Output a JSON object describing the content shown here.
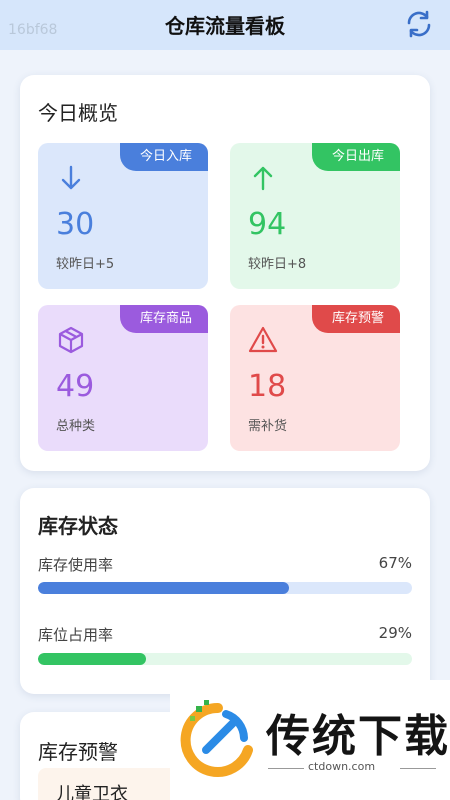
{
  "header": {
    "watermark": "16bf68",
    "title": "仓库流量看板",
    "refresh_icon": "refresh-icon"
  },
  "overview": {
    "title": "今日概览",
    "tiles": [
      {
        "badge": "今日入库",
        "value": "30",
        "sub": "较昨日+5",
        "icon": "arrow-down-icon",
        "color": "#4a7fdc",
        "bg": "#dbe7fb"
      },
      {
        "badge": "今日出库",
        "value": "94",
        "sub": "较昨日+8",
        "icon": "arrow-up-icon",
        "color": "#33c463",
        "bg": "#e3f8ea"
      },
      {
        "badge": "库存商品",
        "value": "49",
        "sub": "总种类",
        "icon": "box-icon",
        "color": "#9b5bde",
        "bg": "#eadcfb"
      },
      {
        "badge": "库存预警",
        "value": "18",
        "sub": "需补货",
        "icon": "warning-icon",
        "color": "#e04a4a",
        "bg": "#fde2e2"
      }
    ]
  },
  "inventory_status": {
    "title": "库存状态",
    "bars": [
      {
        "label": "库存使用率",
        "value_text": "67%",
        "value": 0.67,
        "color": "#4a7fdc",
        "track": "#dbe7fb"
      },
      {
        "label": "库位占用率",
        "value_text": "29%",
        "value": 0.29,
        "color": "#33c463",
        "track": "#e3f8ea"
      }
    ]
  },
  "warnings": {
    "title": "库存预警",
    "items": [
      {
        "name": "儿童卫衣"
      }
    ]
  },
  "logo": {
    "brand": "传统下载",
    "url": "ctdown.com"
  }
}
